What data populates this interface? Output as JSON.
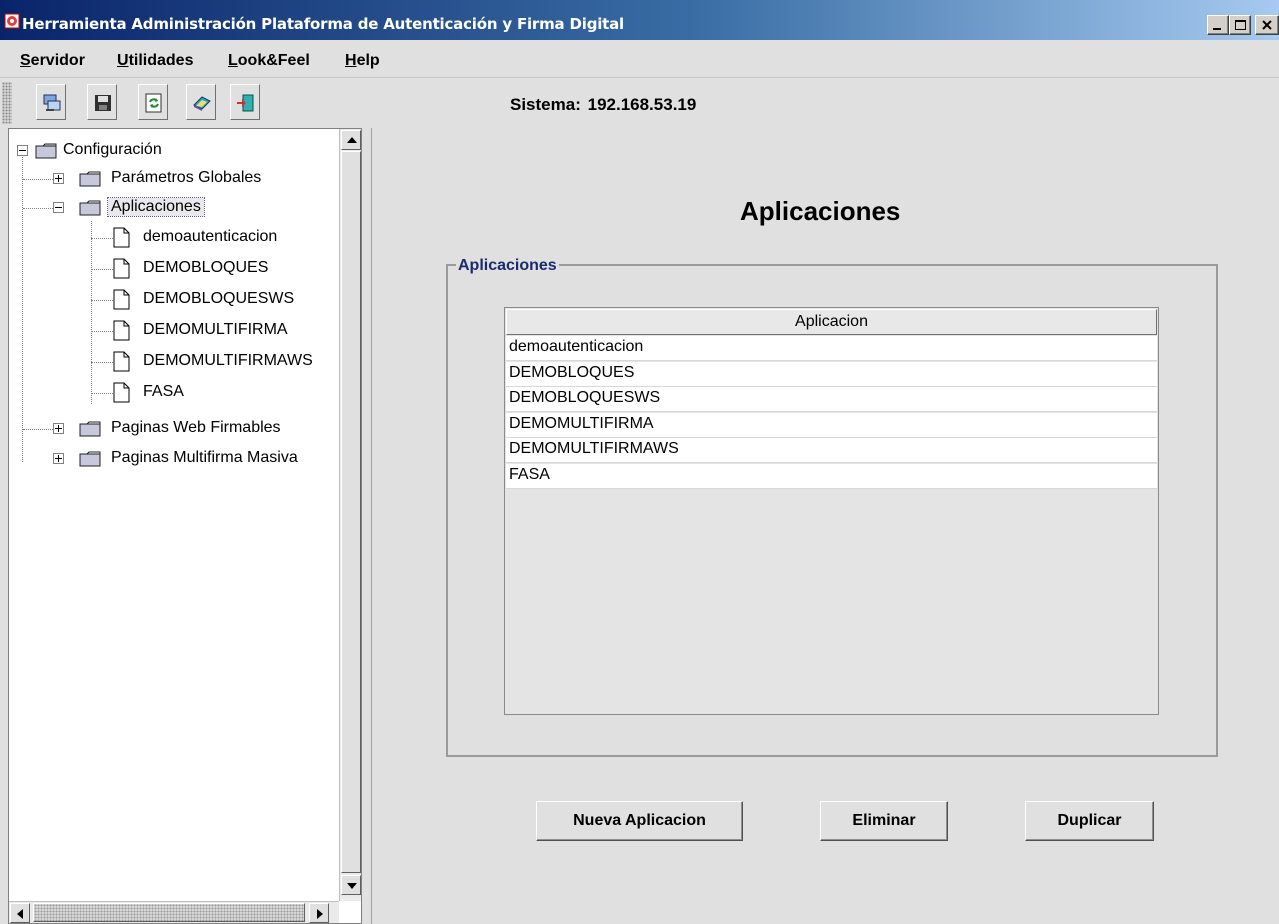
{
  "window": {
    "title": "Herramienta Administración Plataforma de Autenticación y Firma Digital",
    "app_icon": "app-logo-icon",
    "controls": [
      "minimize-icon",
      "maximize-icon",
      "close-icon"
    ]
  },
  "menu": {
    "items": [
      {
        "first": "S",
        "rest": "ervidor"
      },
      {
        "first": "U",
        "rest": "tilidades"
      },
      {
        "first": "L",
        "rest": "ook&Feel"
      },
      {
        "first": "H",
        "rest": "elp"
      }
    ]
  },
  "toolbar": {
    "buttons": [
      "network-computer-icon",
      "save-disk-icon",
      "refresh-icon",
      "book-icon",
      "exit-door-icon"
    ],
    "sistema_label": "Sistema:",
    "sistema_value": "192.168.53.19"
  },
  "tree": {
    "root": "Configuración",
    "parametros": "Parámetros Globales",
    "aplicaciones": "Aplicaciones",
    "children": [
      "demoautenticacion",
      "DEMOBLOQUES",
      "DEMOBLOQUESWS",
      "DEMOMULTIFIRMA",
      "DEMOMULTIFIRMAWS",
      "FASA"
    ],
    "paginas_web": "Paginas Web Firmables",
    "paginas_multi": "Paginas Multifirma Masiva"
  },
  "main": {
    "title": "Aplicaciones",
    "group_legend": "Aplicaciones",
    "table": {
      "header": "Aplicacion",
      "rows": [
        "demoautenticacion",
        "DEMOBLOQUES",
        "DEMOBLOQUESWS",
        "DEMOMULTIFIRMA",
        "DEMOMULTIFIRMAWS",
        "FASA"
      ]
    },
    "buttons": {
      "nueva": "Nueva Aplicacion",
      "eliminar": "Eliminar",
      "duplicar": "Duplicar"
    }
  },
  "colors": {
    "titlebar_start": "#0a246a",
    "titlebar_end": "#a6caf0",
    "legend_text": "#1a2a6c",
    "background": "#e0e0e0"
  }
}
